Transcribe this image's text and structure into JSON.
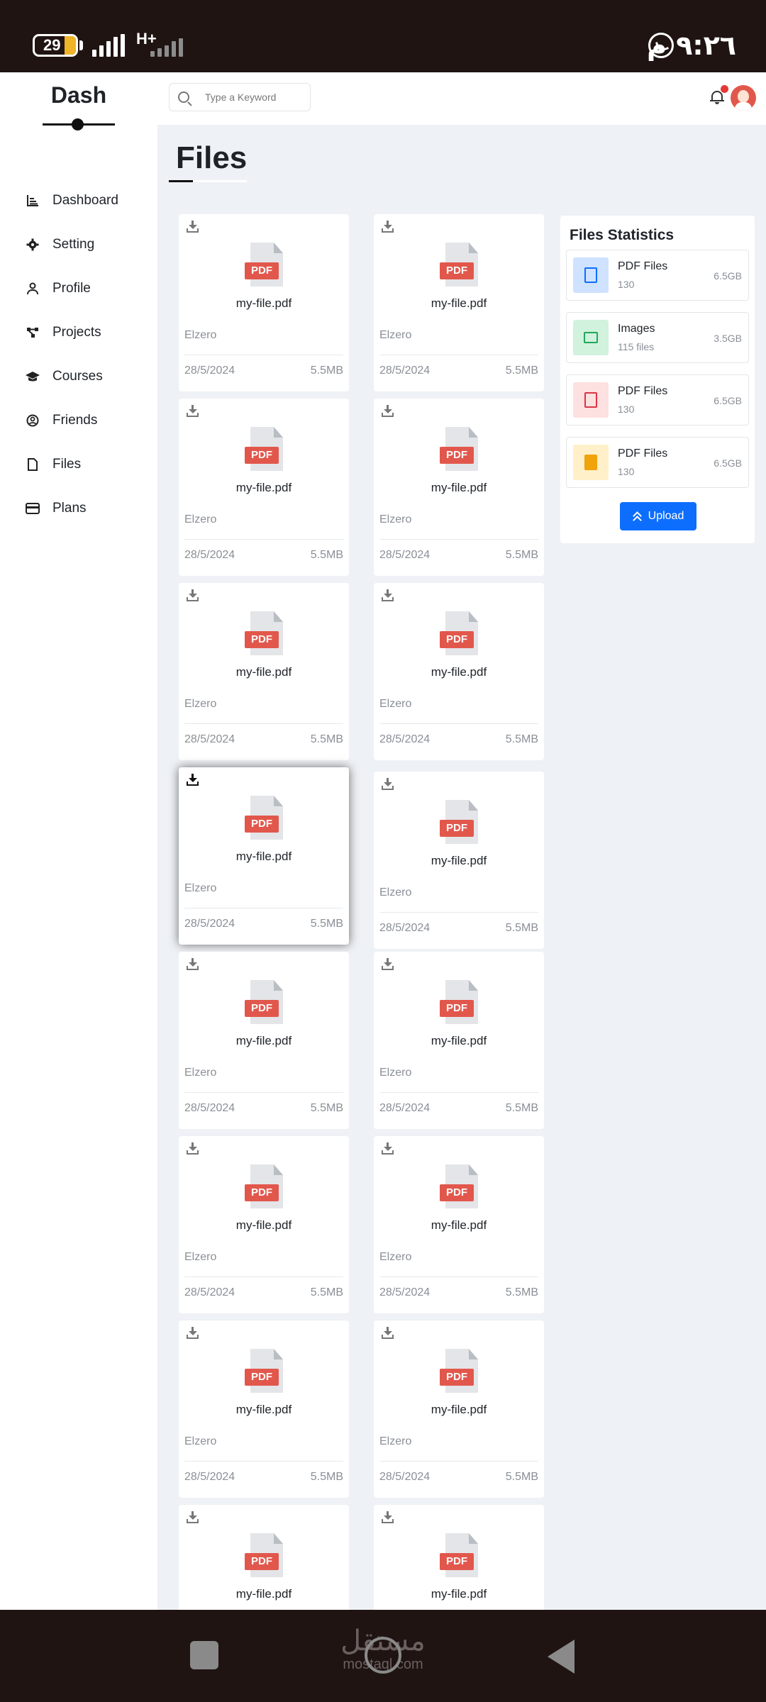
{
  "status_bar": {
    "battery": "29",
    "network": "H+",
    "time": "٩:٢٦ م"
  },
  "sidebar": {
    "brand": "Dash",
    "items": [
      {
        "label": "Dashboard",
        "icon": "chart-icon"
      },
      {
        "label": "Setting",
        "icon": "gear-icon"
      },
      {
        "label": "Profile",
        "icon": "user-icon"
      },
      {
        "label": "Projects",
        "icon": "diagram-icon"
      },
      {
        "label": "Courses",
        "icon": "graduation-cap-icon"
      },
      {
        "label": "Friends",
        "icon": "user-circle-icon"
      },
      {
        "label": "Files",
        "icon": "file-icon"
      },
      {
        "label": "Plans",
        "icon": "credit-card-icon"
      }
    ]
  },
  "topbar": {
    "search_placeholder": "Type a Keyword"
  },
  "page": {
    "title": "Files"
  },
  "files": [
    {
      "name": "my-file.pdf",
      "badge": "PDF",
      "author": "Elzero",
      "date": "28/5/2024",
      "size": "5.5MB"
    },
    {
      "name": "my-file.pdf",
      "badge": "PDF",
      "author": "Elzero",
      "date": "28/5/2024",
      "size": "5.5MB"
    },
    {
      "name": "my-file.pdf",
      "badge": "PDF",
      "author": "Elzero",
      "date": "28/5/2024",
      "size": "5.5MB"
    },
    {
      "name": "my-file.pdf",
      "badge": "PDF",
      "author": "Elzero",
      "date": "28/5/2024",
      "size": "5.5MB"
    },
    {
      "name": "my-file.pdf",
      "badge": "PDF",
      "author": "Elzero",
      "date": "28/5/2024",
      "size": "5.5MB"
    },
    {
      "name": "my-file.pdf",
      "badge": "PDF",
      "author": "Elzero",
      "date": "28/5/2024",
      "size": "5.5MB"
    },
    {
      "name": "my-file.pdf",
      "badge": "PDF",
      "author": "Elzero",
      "date": "28/5/2024",
      "size": "5.5MB"
    },
    {
      "name": "my-file.pdf",
      "badge": "PDF",
      "author": "Elzero",
      "date": "28/5/2024",
      "size": "5.5MB"
    },
    {
      "name": "my-file.pdf",
      "badge": "PDF",
      "author": "Elzero",
      "date": "28/5/2024",
      "size": "5.5MB"
    },
    {
      "name": "my-file.pdf",
      "badge": "PDF",
      "author": "Elzero",
      "date": "28/5/2024",
      "size": "5.5MB"
    },
    {
      "name": "my-file.pdf",
      "badge": "PDF",
      "author": "Elzero",
      "date": "28/5/2024",
      "size": "5.5MB"
    },
    {
      "name": "my-file.pdf",
      "badge": "PDF",
      "author": "Elzero",
      "date": "28/5/2024",
      "size": "5.5MB"
    },
    {
      "name": "my-file.pdf",
      "badge": "PDF",
      "author": "Elzero",
      "date": "28/5/2024",
      "size": "5.5MB"
    },
    {
      "name": "my-file.pdf",
      "badge": "PDF",
      "author": "Elzero",
      "date": "28/5/2024",
      "size": "5.5MB"
    },
    {
      "name": "my-file.pdf",
      "badge": "PDF"
    },
    {
      "name": "my-file.pdf",
      "badge": "PDF"
    }
  ],
  "stats": {
    "title": "Files Statistics",
    "items": [
      {
        "name": "PDF Files",
        "count": "130",
        "size": "6.5GB",
        "icon": "pdf-file-icon",
        "bg": "#cfe2ff",
        "fg": "#0d6efd"
      },
      {
        "name": "Images",
        "count": "115 files",
        "size": "3.5GB",
        "icon": "image-icon",
        "bg": "#d1f2dd",
        "fg": "#22a65a"
      },
      {
        "name": "PDF Files",
        "count": "130",
        "size": "6.5GB",
        "icon": "word-file-icon",
        "bg": "#fde0e0",
        "fg": "#dc3545"
      },
      {
        "name": "PDF Files",
        "count": "130",
        "size": "6.5GB",
        "icon": "csv-file-icon",
        "bg": "#fff0c9",
        "fg": "#f0a30a"
      }
    ],
    "upload_label": "Upload"
  },
  "watermark": {
    "arabic": "مستقل",
    "latin": "mostaql.com"
  },
  "colors": {
    "accent": "#0d6efd",
    "pdf_badge": "#e2574c",
    "notification": "#e53935"
  }
}
